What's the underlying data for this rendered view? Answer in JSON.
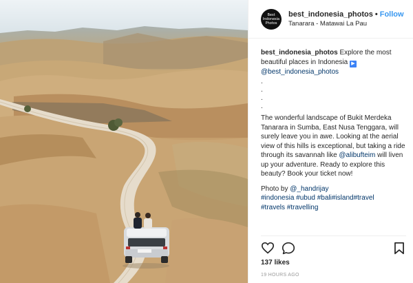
{
  "account": {
    "username": "best_indonesia_photos",
    "avatar_lines": [
      "Best",
      "Indonesia",
      "Photos"
    ],
    "follow_label": "Follow",
    "separator": "•",
    "location": "Tanarara - Matawai La Pau"
  },
  "caption": {
    "username": "best_indonesia_photos",
    "intro": "Explore the most beautiful places in Indonesia",
    "intro_icon": "play-button-icon",
    "mention_1": "@best_indonesia_photos",
    "dots": [
      ".",
      ".",
      ".",
      "."
    ],
    "body_1": "The wonderful landscape of Bukit Merdeka Tanarara in Sumba, East Nusa Tenggara, will surely leave you in awe. Looking at the aerial view of this hills is exceptional, but taking a ride through its savannah like",
    "mention_2": "@alibufteim",
    "body_2": "will liven up your adventure. Ready to explore this beauty? Book your ticket now!",
    "photo_by_label": "Photo by",
    "photo_by_user": "@_handrijay",
    "hashtags": [
      "#indonesia",
      "#ubud",
      "#bali",
      "#island",
      "#travel",
      "#travels",
      "#travelling"
    ]
  },
  "actions": {
    "like_icon": "heart-icon",
    "comment_icon": "comment-icon",
    "save_icon": "bookmark-icon"
  },
  "likes": "137 likes",
  "time": "19 HOURS AGO",
  "colors": {
    "follow": "#3897f0",
    "link": "#003569",
    "avatar_bg": "#111111"
  }
}
